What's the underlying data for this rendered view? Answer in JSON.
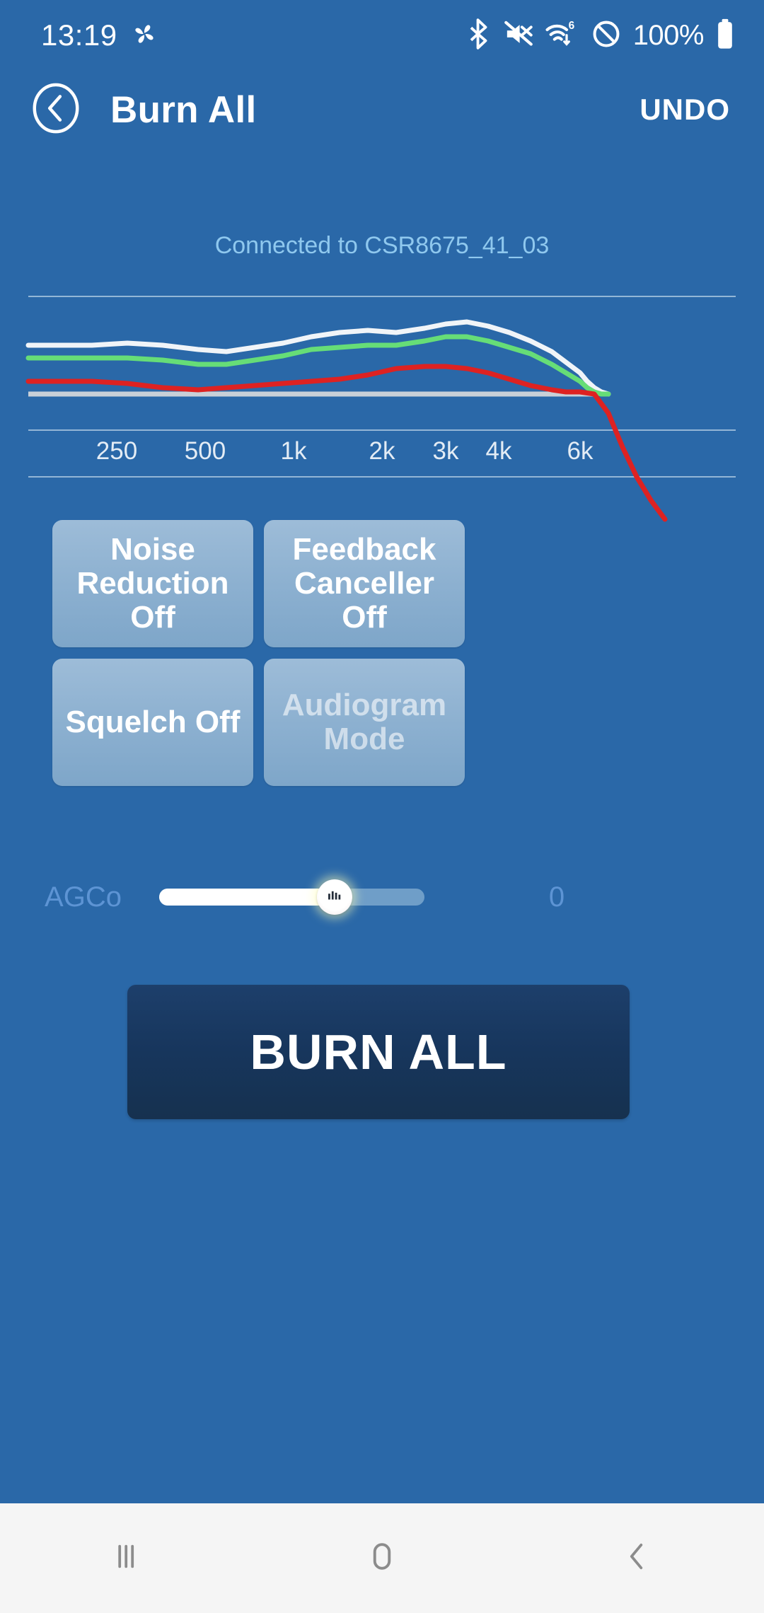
{
  "statusbar": {
    "clock": "13:19",
    "battery_text": "100%",
    "icons": [
      "pinwheel-icon",
      "bluetooth-icon",
      "mute-icon",
      "wifi-6-icon",
      "dnd-icon",
      "battery-icon"
    ]
  },
  "header": {
    "back_icon": "back-chevron-circle-icon",
    "title": "Burn All",
    "undo_label": "UNDO"
  },
  "connection": {
    "status_text": "Connected to CSR8675_41_03",
    "color": "#8fc8ee"
  },
  "chart_data": {
    "type": "line",
    "title": "",
    "xlabel": "",
    "ylabel": "",
    "grid": true,
    "legend": "none",
    "tick_labels": [
      "250",
      "500",
      "1k",
      "2k",
      "3k",
      "4k",
      "6k"
    ],
    "tick_positions_pct": [
      12.5,
      25.0,
      37.5,
      50.0,
      59.0,
      66.5,
      78.0
    ],
    "xlim": [
      0,
      100
    ],
    "ylim": [
      0,
      100
    ],
    "reference_line": {
      "name": "gray-baseline",
      "color": "#c8d0d8",
      "y": 53
    },
    "gridlines_y": [
      7,
      70,
      92
    ],
    "series": [
      {
        "name": "white-response",
        "color": "#f0f4f8",
        "x": [
          0,
          4,
          9,
          14,
          19,
          24,
          28,
          32,
          36,
          40,
          44,
          48,
          52,
          56,
          59,
          62,
          65,
          68,
          71,
          74,
          76,
          78,
          79,
          80,
          81,
          82
        ],
        "y": [
          30,
          30,
          30,
          29,
          30,
          32,
          33,
          31,
          29,
          26,
          24,
          23,
          24,
          22,
          20,
          19,
          21,
          24,
          28,
          33,
          38,
          43,
          47,
          50,
          52,
          53
        ]
      },
      {
        "name": "green-response",
        "color": "#66dd77",
        "x": [
          0,
          4,
          9,
          14,
          19,
          24,
          28,
          32,
          36,
          40,
          44,
          48,
          52,
          56,
          59,
          62,
          65,
          68,
          71,
          74,
          76,
          78,
          79,
          80,
          81,
          82
        ],
        "y": [
          36,
          36,
          36,
          36,
          37,
          39,
          39,
          37,
          35,
          32,
          31,
          30,
          30,
          28,
          26,
          26,
          28,
          31,
          34,
          39,
          43,
          47,
          50,
          52,
          53,
          53
        ]
      },
      {
        "name": "red-response",
        "color": "#dd2222",
        "x": [
          0,
          4,
          9,
          14,
          19,
          24,
          28,
          32,
          36,
          40,
          44,
          48,
          52,
          56,
          59,
          62,
          65,
          68,
          71,
          74,
          76,
          78,
          80,
          82,
          84,
          86,
          88,
          90
        ],
        "y": [
          47,
          47,
          47,
          48,
          50,
          51,
          50,
          49,
          48,
          47,
          46,
          44,
          41,
          40,
          40,
          41,
          43,
          46,
          49,
          51,
          52,
          52,
          53,
          62,
          78,
          92,
          103,
          112
        ]
      }
    ]
  },
  "toggles": [
    {
      "id": "noise-reduction",
      "label": "Noise\nReduction Off",
      "state": "off",
      "disabled": false
    },
    {
      "id": "feedback-canceller",
      "label": "Feedback\nCanceller Off",
      "state": "off",
      "disabled": false
    },
    {
      "id": "squelch",
      "label": "Squelch Off",
      "state": "off",
      "disabled": false
    },
    {
      "id": "audiogram-mode",
      "label": "Audiogram\nMode",
      "state": "disabled",
      "disabled": true
    }
  ],
  "slider": {
    "label": "AGCo",
    "value": "0",
    "fill_percent": 66,
    "thumb_icon": "equalizer-bars-icon",
    "label_color": "#5d94d4"
  },
  "burn_button": {
    "label": "BURN ALL"
  },
  "navbar": {
    "recents_icon": "recents-icon",
    "home_icon": "home-icon",
    "back_icon": "back-icon"
  },
  "theme": {
    "background": "#2a68a8",
    "button_face": "#8cb0d0",
    "burn_button": "#17365d",
    "accent_text": "#8fc8ee"
  }
}
